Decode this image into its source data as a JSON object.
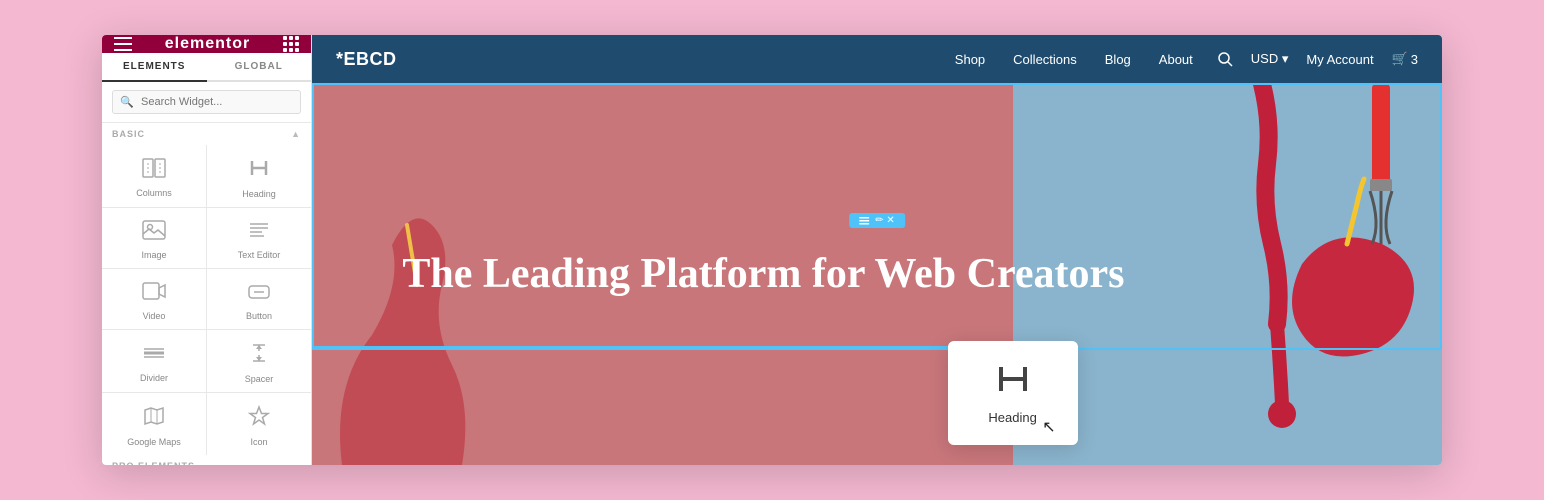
{
  "sidebar": {
    "logo": "elementor",
    "tabs": [
      {
        "label": "ELEMENTS",
        "active": true
      },
      {
        "label": "GLOBAL",
        "active": false
      }
    ],
    "search_placeholder": "Search Widget...",
    "section_label": "BASIC",
    "widgets": [
      {
        "id": "columns",
        "label": "Columns",
        "icon": "columns"
      },
      {
        "id": "heading",
        "label": "Heading",
        "icon": "heading"
      },
      {
        "id": "image",
        "label": "Image",
        "icon": "image"
      },
      {
        "id": "text-editor",
        "label": "Text Editor",
        "icon": "text-editor"
      },
      {
        "id": "video",
        "label": "Video",
        "icon": "video"
      },
      {
        "id": "button",
        "label": "Button",
        "icon": "button"
      },
      {
        "id": "divider",
        "label": "Divider",
        "icon": "divider"
      },
      {
        "id": "spacer",
        "label": "Spacer",
        "icon": "spacer"
      },
      {
        "id": "google-maps",
        "label": "Google Maps",
        "icon": "map"
      },
      {
        "id": "icon",
        "label": "Icon",
        "icon": "star"
      }
    ],
    "pro_label": "PRO ELEMENTS"
  },
  "navbar": {
    "brand": "*EBCD",
    "links": [
      "Shop",
      "Collections",
      "Blog",
      "About"
    ],
    "actions": [
      "search",
      "USD",
      "My Account"
    ],
    "cart_count": "3"
  },
  "hero": {
    "title": "The Leading Platform for Web Creators",
    "bg_left_color": "#c8767a",
    "bg_right_color": "#8ab4cd"
  },
  "edit_handle": {
    "label": "Edit"
  },
  "floating_widget": {
    "label": "Heading"
  }
}
